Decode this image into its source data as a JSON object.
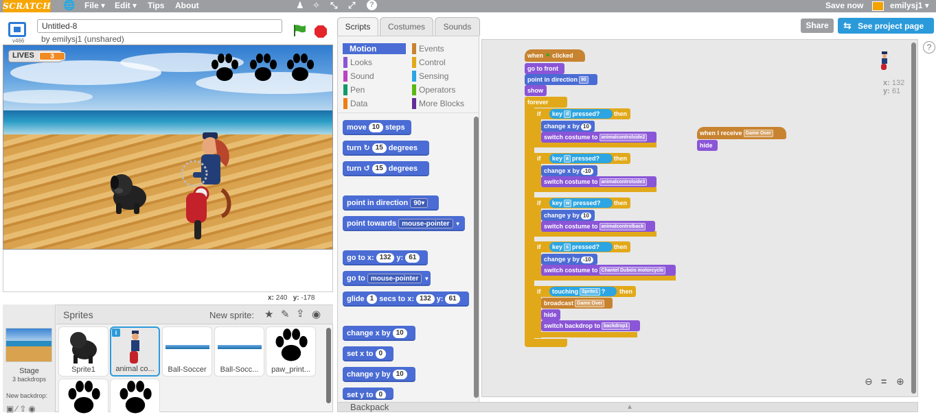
{
  "topbar": {
    "logo": "SCRATCH",
    "menu": [
      "File ▾",
      "Edit ▾",
      "Tips",
      "About"
    ],
    "save_now": "Save now",
    "username": "emilysj1 ▾"
  },
  "project": {
    "title_value": "Untitled-8",
    "byline": "by emilysj1 (unshared)",
    "version": "v466"
  },
  "stage": {
    "lives_label": "LIVES",
    "lives_value": "3",
    "x_label": "x:",
    "x_value": "240",
    "y_label": "y:",
    "y_value": "-178"
  },
  "sprites_panel": {
    "header": "Sprites",
    "new_sprite": "New sprite:",
    "stage_label": "Stage",
    "stage_backdrops": "3 backdrops",
    "new_backdrop": "New backdrop:",
    "sprites": [
      {
        "name": "Sprite1"
      },
      {
        "name": "animal co..."
      },
      {
        "name": "Ball-Soccer"
      },
      {
        "name": "Ball-Socc..."
      },
      {
        "name": "paw_print..."
      }
    ]
  },
  "tabs": [
    "Scripts",
    "Costumes",
    "Sounds"
  ],
  "share": {
    "share": "Share",
    "see_project": "See project page"
  },
  "categories": [
    {
      "name": "Motion",
      "color": "#4a6cd4"
    },
    {
      "name": "Events",
      "color": "#c88330"
    },
    {
      "name": "Looks",
      "color": "#8a55d7"
    },
    {
      "name": "Control",
      "color": "#e1a91a"
    },
    {
      "name": "Sound",
      "color": "#bb42c3"
    },
    {
      "name": "Sensing",
      "color": "#2ca5e2"
    },
    {
      "name": "Pen",
      "color": "#0e9a6c"
    },
    {
      "name": "Operators",
      "color": "#5cb712"
    },
    {
      "name": "Data",
      "color": "#ee7d16"
    },
    {
      "name": "More Blocks",
      "color": "#632d99"
    }
  ],
  "palette": {
    "move": "move",
    "move_n": "10",
    "steps": "steps",
    "turn": "turn",
    "turn_cw_n": "15",
    "turn_ccw_n": "15",
    "degrees": "degrees",
    "point_dir": "point in direction",
    "point_dir_v": "90▾",
    "point_towards": "point towards",
    "mouse_pointer": "mouse-pointer",
    "goto_xy": "go to x:",
    "goto_x": "132",
    "y_lbl": "y:",
    "goto_y": "61",
    "goto": "go to",
    "glide": "glide",
    "glide_n": "1",
    "secs_to_x": "secs to x:",
    "glide_x": "132",
    "glide_y": "61",
    "change_x": "change x by",
    "change_x_n": "10",
    "set_x": "set x to",
    "set_x_n": "0",
    "change_y": "change y by",
    "change_y_n": "10",
    "set_y": "set y to",
    "set_y_n": "0"
  },
  "script": {
    "when_flag": "when",
    "clicked": "clicked",
    "go_front": "go to front",
    "point_dir": "point in direction",
    "point_dir_v": "90",
    "show": "show",
    "forever": "forever",
    "if": "if",
    "then": "then",
    "key": "key",
    "pressed": "pressed?",
    "key1": "d",
    "key2": "a",
    "key3": "w",
    "key4": "s",
    "change_x": "change x by",
    "cx1": "10",
    "cx2": "-10",
    "change_y": "change y by",
    "cy1": "10",
    "cy2": "-10",
    "switch_costume": "switch costume to",
    "cos1": "animalcontrolside2",
    "cos2": "animalcontrolside3",
    "cos3": "animalcontrolback",
    "cos4": "Chantel Dubois motorcycle",
    "touching": "touching",
    "touch_target": "Sprite1",
    "q": "?",
    "broadcast": "broadcast",
    "bc_msg": "Game Over",
    "hide": "hide",
    "switch_backdrop": "switch backdrop to",
    "backdrop": "backdrop1",
    "when_receive": "when I receive",
    "recv_msg": "Game Over",
    "hide2": "hide"
  },
  "sprite_info": {
    "x_label": "x:",
    "x": "132",
    "y_label": "y:",
    "y": "61"
  },
  "backpack": "Backpack"
}
